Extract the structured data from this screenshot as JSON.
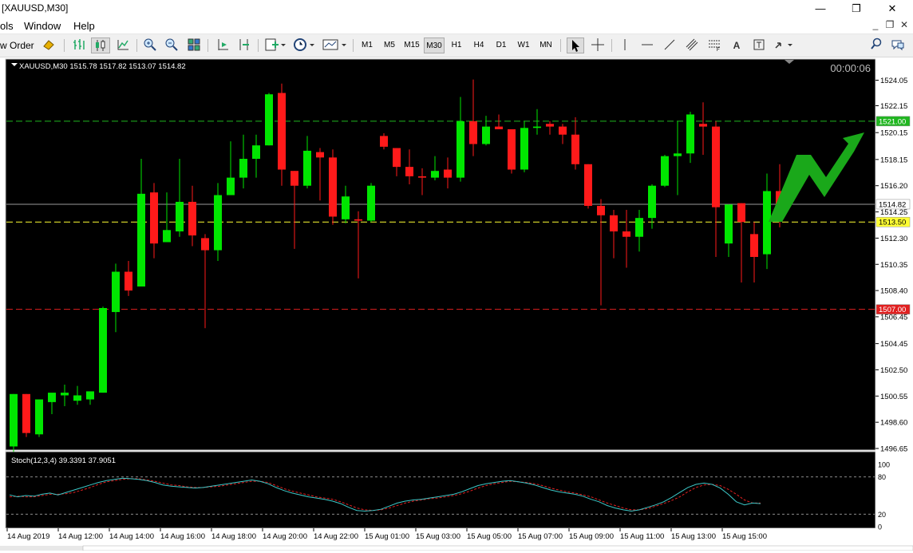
{
  "window": {
    "title": "[XAUUSD,M30]",
    "minimize": "—",
    "restore": "❐",
    "close": "✕"
  },
  "menu": {
    "items": [
      "ols",
      "Window",
      "Help"
    ],
    "sub_min": "_",
    "sub_restore": "❐",
    "sub_close": "✕"
  },
  "toolbar": {
    "new_order": "w Order",
    "timeframes": [
      "M1",
      "M5",
      "M15",
      "M30",
      "H1",
      "H4",
      "D1",
      "W1",
      "MN"
    ],
    "active_timeframe": "M30"
  },
  "chart": {
    "header": "XAUUSD,M30  1515.78 1517.82 1513.07 1514.82",
    "countdown": "00:00:06",
    "price_labels": [
      "1524.05",
      "1522.15",
      "1520.15",
      "1518.15",
      "1516.20",
      "1514.25",
      "1512.30",
      "1510.35",
      "1508.40",
      "1506.45",
      "1504.45",
      "1502.50",
      "1500.55",
      "1498.60",
      "1496.65"
    ],
    "tags": [
      {
        "text": "1521.00",
        "color": "#1fb61f"
      },
      {
        "text": "1514.82",
        "color": "#ffffff"
      },
      {
        "text": "1513.50",
        "color": "#ffff33"
      },
      {
        "text": "1507.00",
        "color": "#e02020"
      }
    ],
    "time_labels": [
      "14 Aug 2019",
      "14 Aug 12:00",
      "14 Aug 14:00",
      "14 Aug 16:00",
      "14 Aug 18:00",
      "14 Aug 20:00",
      "14 Aug 22:00",
      "15 Aug 01:00",
      "15 Aug 03:00",
      "15 Aug 05:00",
      "15 Aug 07:00",
      "15 Aug 09:00",
      "15 Aug 11:00",
      "15 Aug 13:00",
      "15 Aug 15:00"
    ],
    "colors": {
      "bull": "#00e600",
      "bear": "#ff1a1a",
      "bg": "#000000",
      "grid_text": "#ffffff",
      "arrow": "#1aa81a"
    }
  },
  "stoch": {
    "header": "Stoch(12,3,4) 39.3391 37.9051",
    "scale_labels": [
      "100",
      "80",
      "20",
      "0"
    ],
    "main_color": "#3cc8c8",
    "signal_color": "#e02020"
  },
  "chart_data": {
    "type": "candlestick",
    "symbol": "XAUUSD",
    "timeframe": "M30",
    "ylim": [
      1496.65,
      1524.05
    ],
    "levels": [
      1521.0,
      1514.82,
      1513.5,
      1507.0
    ],
    "candles": [
      [
        1496.8,
        1500.7,
        1496.4,
        1500.7
      ],
      [
        1500.7,
        1497.8,
        1497.5,
        1500.7
      ],
      [
        1497.7,
        1500.3,
        1497.5,
        1500.3
      ],
      [
        1500.1,
        1500.8,
        1499.2,
        1500.6
      ],
      [
        1500.6,
        1500.8,
        1499.8,
        1501.4
      ],
      [
        1500.2,
        1500.6,
        1499.9,
        1501.3
      ],
      [
        1500.3,
        1500.9,
        1499.9,
        1500.7
      ],
      [
        1500.8,
        1507.1,
        1500.8,
        1507.2
      ],
      [
        1506.8,
        1509.8,
        1505.3,
        1510.4
      ],
      [
        1509.8,
        1508.4,
        1508.0,
        1510.6
      ],
      [
        1508.7,
        1515.6,
        1508.7,
        1518.2
      ],
      [
        1515.7,
        1511.9,
        1510.8,
        1516.4
      ],
      [
        1512.0,
        1512.9,
        1512.0,
        1515.7
      ],
      [
        1512.8,
        1515.0,
        1512.4,
        1518.2
      ],
      [
        1515.0,
        1512.5,
        1511.7,
        1516.2
      ],
      [
        1512.3,
        1511.4,
        1505.6,
        1512.6
      ],
      [
        1511.4,
        1515.5,
        1510.6,
        1516.4
      ],
      [
        1515.5,
        1516.8,
        1515.5,
        1519.5
      ],
      [
        1516.8,
        1518.2,
        1516.0,
        1520.0
      ],
      [
        1518.2,
        1519.2,
        1516.8,
        1520.0
      ],
      [
        1519.2,
        1523.0,
        1519.2,
        1523.1
      ],
      [
        1523.1,
        1517.4,
        1516.2,
        1523.8
      ],
      [
        1517.3,
        1516.2,
        1511.5,
        1517.3
      ],
      [
        1516.2,
        1518.8,
        1516.0,
        1519.9
      ],
      [
        1518.7,
        1518.3,
        1515.1,
        1519.0
      ],
      [
        1518.3,
        1513.9,
        1513.3,
        1518.9
      ],
      [
        1513.7,
        1515.4,
        1513.4,
        1516.2
      ],
      [
        1513.7,
        1513.6,
        1509.3,
        1514.3
      ],
      [
        1513.6,
        1516.2,
        1513.5,
        1516.4
      ],
      [
        1519.9,
        1519.1,
        1518.9,
        1520.1
      ],
      [
        1519.0,
        1517.6,
        1516.9,
        1519.0
      ],
      [
        1517.6,
        1516.9,
        1516.3,
        1518.9
      ],
      [
        1516.9,
        1516.8,
        1515.5,
        1517.5
      ],
      [
        1516.8,
        1517.3,
        1516.6,
        1518.4
      ],
      [
        1517.4,
        1516.8,
        1516.0,
        1518.3
      ],
      [
        1516.8,
        1521.0,
        1516.5,
        1522.8
      ],
      [
        1521.0,
        1519.3,
        1518.4,
        1524.1
      ],
      [
        1519.3,
        1520.6,
        1519.2,
        1521.4
      ],
      [
        1520.6,
        1520.4,
        1520.4,
        1521.5
      ],
      [
        1520.4,
        1517.4,
        1517.1,
        1520.4
      ],
      [
        1517.4,
        1520.5,
        1517.2,
        1521.0
      ],
      [
        1520.5,
        1520.6,
        1520.0,
        1521.9
      ],
      [
        1520.8,
        1520.6,
        1520.0,
        1521.0
      ],
      [
        1520.6,
        1520.0,
        1519.3,
        1520.8
      ],
      [
        1520.0,
        1517.8,
        1517.4,
        1521.3
      ],
      [
        1517.8,
        1514.7,
        1514.5,
        1517.8
      ],
      [
        1514.7,
        1514.0,
        1507.3,
        1515.2
      ],
      [
        1514.0,
        1512.8,
        1510.8,
        1514.4
      ],
      [
        1512.8,
        1512.4,
        1510.1,
        1514.4
      ],
      [
        1512.4,
        1513.8,
        1511.3,
        1514.4
      ],
      [
        1513.8,
        1516.2,
        1513.0,
        1516.3
      ],
      [
        1516.2,
        1518.4,
        1516.1,
        1518.5
      ],
      [
        1518.4,
        1518.6,
        1515.5,
        1521.0
      ],
      [
        1518.6,
        1521.5,
        1517.9,
        1521.7
      ],
      [
        1520.8,
        1520.6,
        1518.5,
        1522.4
      ],
      [
        1520.6,
        1514.6,
        1510.9,
        1521.0
      ],
      [
        1511.9,
        1514.8,
        1510.9,
        1514.8
      ],
      [
        1514.9,
        1513.5,
        1509.0,
        1514.9
      ],
      [
        1512.6,
        1510.9,
        1509.0,
        1513.5
      ],
      [
        1511.1,
        1515.8,
        1510.0,
        1517.1
      ],
      [
        1515.8,
        1514.8,
        1513.1,
        1517.8
      ]
    ],
    "stoch_main": [
      51,
      48,
      50,
      49,
      52,
      54,
      51,
      55,
      59,
      63,
      67,
      71,
      74,
      76,
      78,
      77,
      76,
      74,
      71,
      67,
      65,
      64,
      63,
      62,
      63,
      65,
      67,
      69,
      71,
      73,
      75,
      73,
      69,
      63,
      58,
      54,
      51,
      48,
      46,
      44,
      41,
      37,
      31,
      26,
      25,
      26,
      28,
      33,
      38,
      41,
      43,
      44,
      46,
      48,
      50,
      52,
      56,
      61,
      66,
      69,
      71,
      73,
      74,
      72,
      70,
      67,
      63,
      59,
      56,
      54,
      52,
      49,
      44,
      40,
      34,
      30,
      27,
      25,
      27,
      31,
      35,
      40,
      47,
      55,
      63,
      68,
      70,
      68,
      62,
      52,
      40,
      35,
      38,
      37
    ],
    "stoch_signal": [
      48,
      49,
      48,
      48,
      50,
      52,
      52,
      53,
      55,
      59,
      63,
      68,
      72,
      74,
      76,
      77,
      77,
      75,
      73,
      70,
      67,
      66,
      64,
      63,
      63,
      64,
      65,
      67,
      69,
      71,
      73,
      73,
      71,
      66,
      61,
      57,
      54,
      51,
      48,
      46,
      44,
      40,
      35,
      30,
      27,
      26,
      27,
      30,
      34,
      38,
      41,
      43,
      45,
      46,
      48,
      50,
      53,
      57,
      62,
      66,
      69,
      71,
      73,
      72,
      71,
      69,
      66,
      62,
      59,
      56,
      54,
      51,
      48,
      43,
      38,
      34,
      30,
      27,
      27,
      29,
      33,
      37,
      42,
      48,
      56,
      63,
      67,
      68,
      66,
      60,
      52,
      43,
      38,
      38
    ]
  }
}
